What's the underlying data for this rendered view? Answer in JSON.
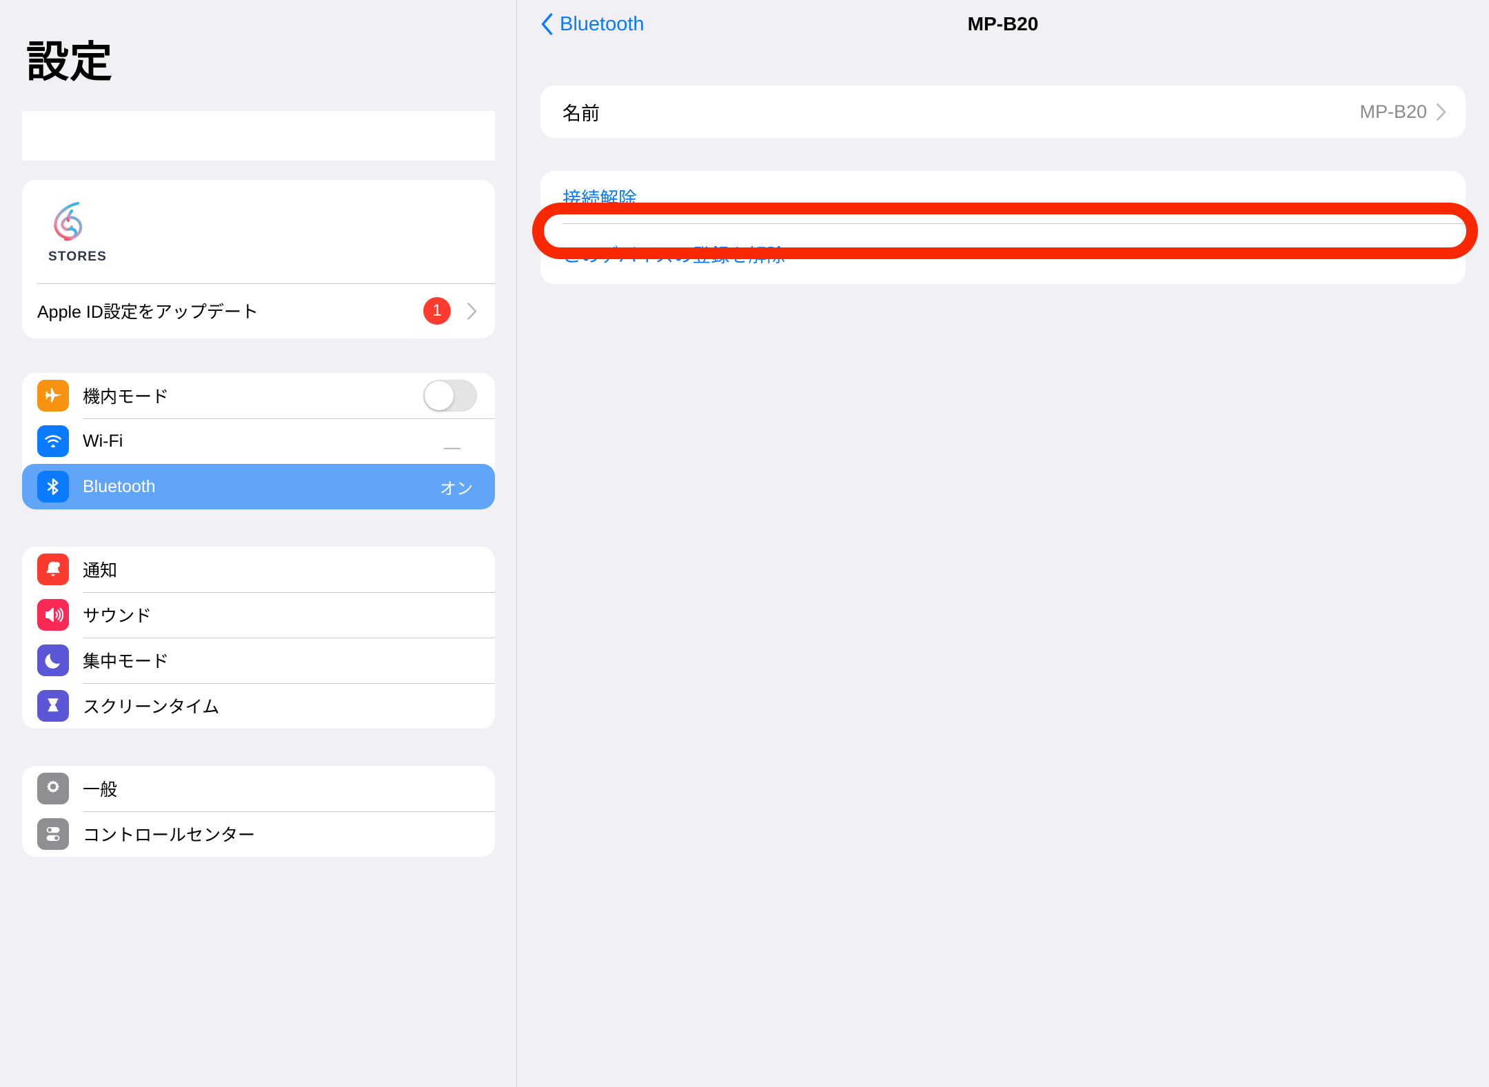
{
  "sidebar": {
    "title": "設定",
    "search": {
      "placeholder": ""
    },
    "account": {
      "logo_name": "stores-logo",
      "logo_word": "STORES",
      "update_label": "Apple ID設定をアップデート",
      "badge_count": "1",
      "chevron": "chevron-right-icon"
    },
    "groups": [
      {
        "items": [
          {
            "label": "機内モード",
            "icon": "airplane-icon",
            "icon_color": "#f79310",
            "accessory": "toggle",
            "toggle_on": false
          },
          {
            "label": "Wi-Fi",
            "icon": "wifi-icon",
            "icon_color": "#0a7aff",
            "accessory": "value",
            "value": "—"
          },
          {
            "label": "Bluetooth",
            "icon": "bluetooth-icon",
            "icon_color": "#0a7aff",
            "accessory": "value",
            "value": "オン",
            "selected": true
          }
        ]
      },
      {
        "items": [
          {
            "label": "通知",
            "icon": "notification-bell-icon",
            "icon_color": "#fb3b30",
            "accessory": "none"
          },
          {
            "label": "サウンド",
            "icon": "speaker-icon",
            "icon_color": "#fa2a56",
            "accessory": "none"
          },
          {
            "label": "集中モード",
            "icon": "moon-icon",
            "icon_color": "#5a56d6",
            "accessory": "none"
          },
          {
            "label": "スクリーンタイム",
            "icon": "hourglass-icon",
            "icon_color": "#5a56d6",
            "accessory": "none"
          }
        ]
      },
      {
        "items": [
          {
            "label": "一般",
            "icon": "gear-icon",
            "icon_color": "#8e8e93",
            "accessory": "none"
          },
          {
            "label": "コントロールセンター",
            "icon": "control-center-icon",
            "icon_color": "#8e8e93",
            "accessory": "none"
          }
        ]
      }
    ]
  },
  "detail": {
    "back_label": "Bluetooth",
    "title": "MP-B20",
    "name_row": {
      "label": "名前",
      "value": "MP-B20",
      "chevron": "chevron-right-icon"
    },
    "actions": [
      {
        "label": "接続解除",
        "name": "disconnect-action"
      },
      {
        "label": "このデバイスの登録を解除",
        "name": "forget-device-action",
        "highlighted": true
      }
    ]
  },
  "colors": {
    "accent_blue": "#0a7aff",
    "selection_blue": "#60a5f7",
    "highlight_red": "#fa2800",
    "badge_red": "#ff3b30",
    "page_bg": "#f1f1f5",
    "card_bg": "#ffffff"
  }
}
